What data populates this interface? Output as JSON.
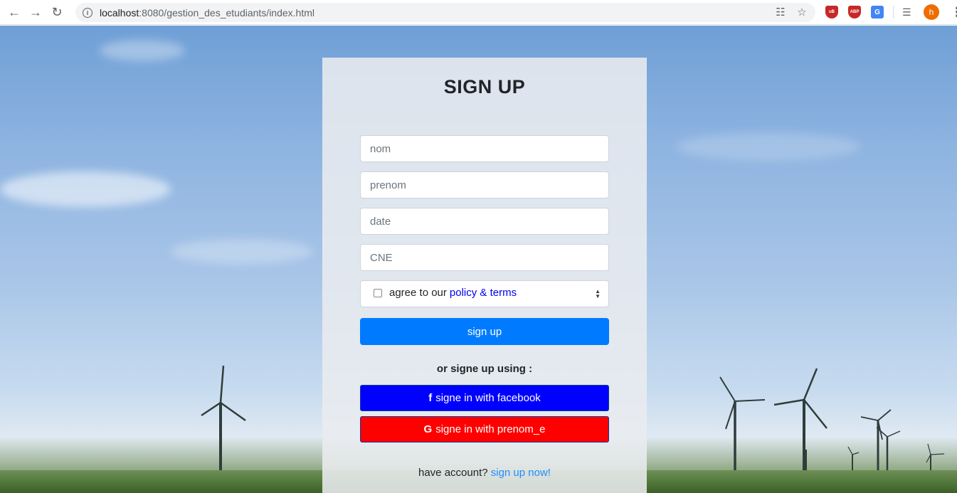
{
  "browser": {
    "url_host": "localhost",
    "url_path": ":8080/gestion_des_etudiants/index.html",
    "avatar_letter": "h"
  },
  "form": {
    "title": "SIGN UP",
    "fields": {
      "nom_placeholder": "nom",
      "prenom_placeholder": "prenom",
      "date_placeholder": "date",
      "cne_placeholder": "CNE",
      "select_value": ""
    },
    "terms_prefix": "agree to our",
    "terms_link": "policy & terms",
    "submit_label": "sign up",
    "or_text": "or signe up using :",
    "facebook_icon": "f",
    "facebook_label": "signe in with facebook",
    "google_icon": "G",
    "google_label": "signe in with prenom_e",
    "have_account_text": "have account?",
    "sign_up_now_link": "sign up now!"
  },
  "colors": {
    "primary": "#007bff",
    "facebook": "#0000ff",
    "google": "#ff0000",
    "link": "#0000ee"
  }
}
